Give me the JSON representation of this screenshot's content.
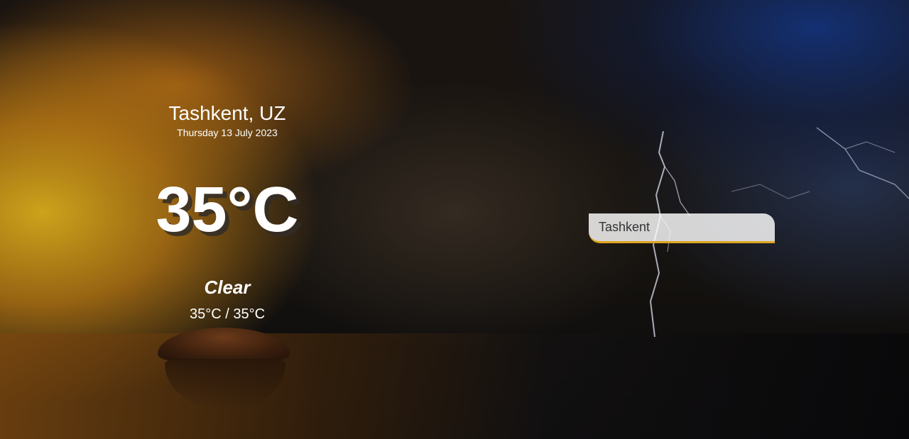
{
  "location": {
    "city": "Tashkent, UZ",
    "date": "Thursday 13 July 2023"
  },
  "current": {
    "temperature": "35°C",
    "condition": "Clear",
    "hi_low": "35°C / 35°C"
  },
  "search": {
    "value": "Tashkent"
  },
  "colors": {
    "accent": "#dfa520",
    "text": "#ffffff"
  }
}
